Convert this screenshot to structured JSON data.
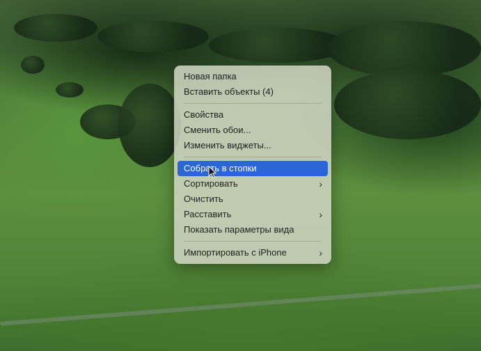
{
  "menu": {
    "items": [
      {
        "label": "Новая папка"
      },
      {
        "label": "Вставить объекты (4)"
      },
      {
        "label": "Свойства"
      },
      {
        "label": "Сменить обои..."
      },
      {
        "label": "Изменить виджеты..."
      },
      {
        "label": "Собрать в стопки",
        "active": true
      },
      {
        "label": "Сортировать",
        "submenu": true
      },
      {
        "label": "Очистить"
      },
      {
        "label": "Расставить",
        "submenu": true
      },
      {
        "label": "Показать параметры вида"
      },
      {
        "label": "Импортировать с iPhone",
        "submenu": true
      }
    ]
  },
  "icons": {
    "submenu_chevron": "chevron-right-icon",
    "cursor": "pointer-cursor-icon"
  },
  "colors": {
    "highlight": "#2a66d6",
    "menu_background": "#d0d6c4"
  }
}
